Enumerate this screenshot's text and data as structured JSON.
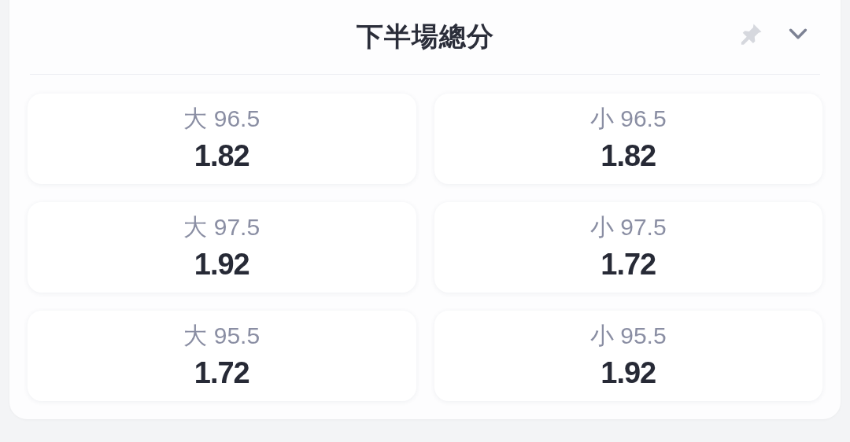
{
  "title": "下半場總分",
  "options": [
    {
      "label": "大 96.5",
      "odds": "1.82"
    },
    {
      "label": "小 96.5",
      "odds": "1.82"
    },
    {
      "label": "大 97.5",
      "odds": "1.92"
    },
    {
      "label": "小 97.5",
      "odds": "1.72"
    },
    {
      "label": "大 95.5",
      "odds": "1.72"
    },
    {
      "label": "小 95.5",
      "odds": "1.92"
    }
  ]
}
